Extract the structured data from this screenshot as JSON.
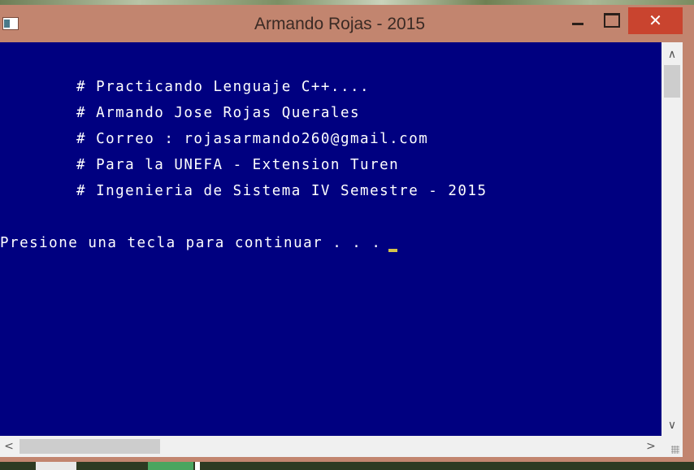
{
  "window": {
    "title": "Armando Rojas - 2015",
    "buttons": {
      "minimize": "minimize-icon",
      "maximize": "maximize-icon",
      "close": "✕"
    }
  },
  "console": {
    "lines": [
      "# Practicando Lenguaje C++....",
      "# Armando Jose Rojas Querales",
      "# Correo : rojasarmando260@gmail.com",
      "# Para la UNEFA - Extension Turen",
      "# Ingenieria de Sistema IV Semestre - 2015"
    ],
    "prompt": "Presione una tecla para continuar . . . "
  },
  "scrollbars": {
    "up": "∧",
    "down": "∨",
    "left": "<",
    "right": ">"
  },
  "colors": {
    "titlebar": "#c2856f",
    "console_background": "#000080",
    "console_text": "#ffffff",
    "close_button": "#c9442f"
  }
}
